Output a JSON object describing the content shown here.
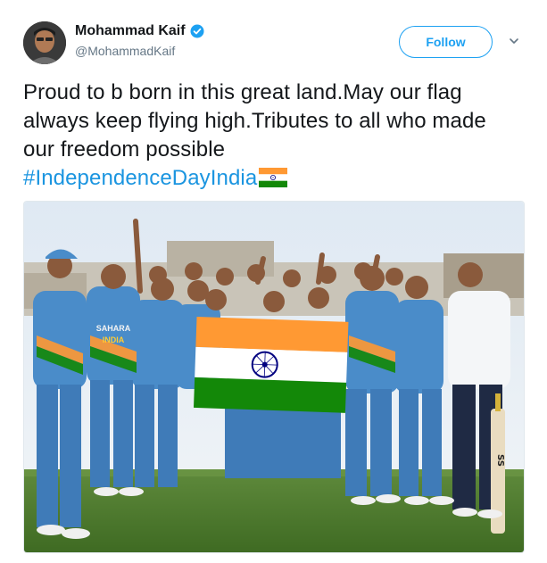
{
  "author": {
    "display_name": "Mohammad Kaif",
    "handle": "@MohammadKaif",
    "verified": true
  },
  "actions": {
    "follow_label": "Follow"
  },
  "tweet": {
    "text": "Proud to b born in this great land.May our flag always keep flying high.Tributes to all who made our freedom possible",
    "hashtag": "#IndependenceDayIndia",
    "emoji": "india-flag-emoji"
  },
  "photo": {
    "jersey_text": [
      "SAHARA",
      "INDIA"
    ],
    "bat_text": "SS"
  },
  "colors": {
    "accent": "#1da1f2",
    "hashtag": "#1b95e0",
    "secondary_text": "#657786",
    "saffron": "#ff9933",
    "india_green": "#138808",
    "chakra_blue": "#000080"
  }
}
